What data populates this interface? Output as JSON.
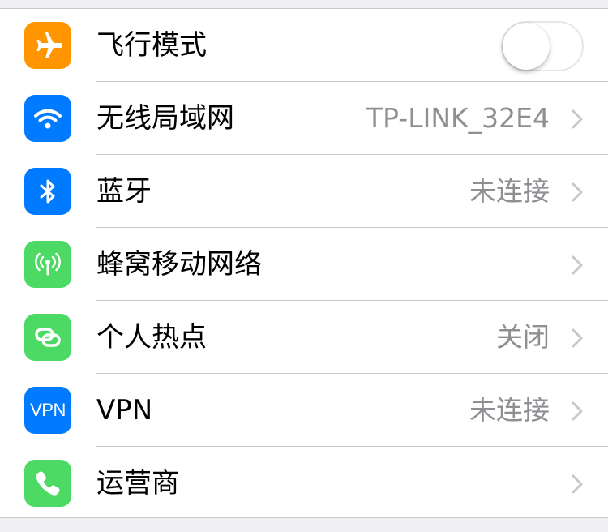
{
  "settings": {
    "rows": [
      {
        "label": "飞行模式",
        "icon": "airplane-icon",
        "icon_color": "#ff9500",
        "toggle_on": false
      },
      {
        "label": "无线局域网",
        "icon": "wifi-icon",
        "icon_color": "#007aff",
        "value": "TP-LINK_32E4"
      },
      {
        "label": "蓝牙",
        "icon": "bluetooth-icon",
        "icon_color": "#007aff",
        "value": "未连接"
      },
      {
        "label": "蜂窝移动网络",
        "icon": "cellular-antenna-icon",
        "icon_color": "#4cd964",
        "value": ""
      },
      {
        "label": "个人热点",
        "icon": "hotspot-link-icon",
        "icon_color": "#4cd964",
        "value": "关闭"
      },
      {
        "label": "VPN",
        "icon": "vpn-icon",
        "icon_text": "VPN",
        "icon_color": "#007aff",
        "value": "未连接"
      },
      {
        "label": "运营商",
        "icon": "phone-icon",
        "icon_color": "#4cd964",
        "value": ""
      }
    ]
  },
  "colors": {
    "background": "#efeff4",
    "separator": "#c8c7cc",
    "secondary_text": "#8e8e93",
    "chevron": "#c7c7cc"
  }
}
